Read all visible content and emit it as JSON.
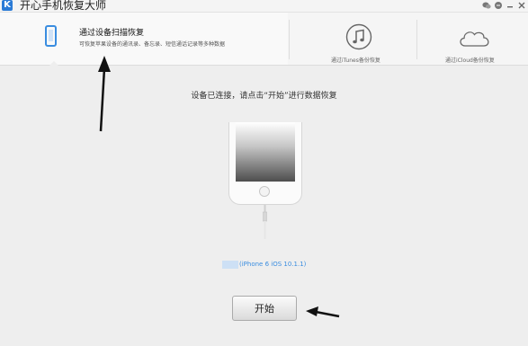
{
  "app": {
    "title": "开心手机恢复大师"
  },
  "window_controls": {
    "wechat": "wechat-icon",
    "chat": "chat-icon",
    "minimize": "minimize-icon",
    "close": "close-icon"
  },
  "modes": {
    "device_scan": {
      "title": "通过设备扫描恢复",
      "desc": "可恢复苹果设备的通讯录、备忘录、短信通话记录等多种数据",
      "icon": "phone-icon"
    },
    "itunes": {
      "label": "通过iTunes备份恢复",
      "icon": "music-note-icon"
    },
    "icloud": {
      "label": "通过iCloud备份恢复",
      "icon": "cloud-icon"
    }
  },
  "main": {
    "prompt": "设备已连接，请点击“开始”进行数据恢复",
    "device_label": "(iPhone 6 iOS 10.1.1)",
    "start_button": "开始"
  },
  "colors": {
    "accent": "#3a8de0",
    "background": "#eeeeee"
  }
}
